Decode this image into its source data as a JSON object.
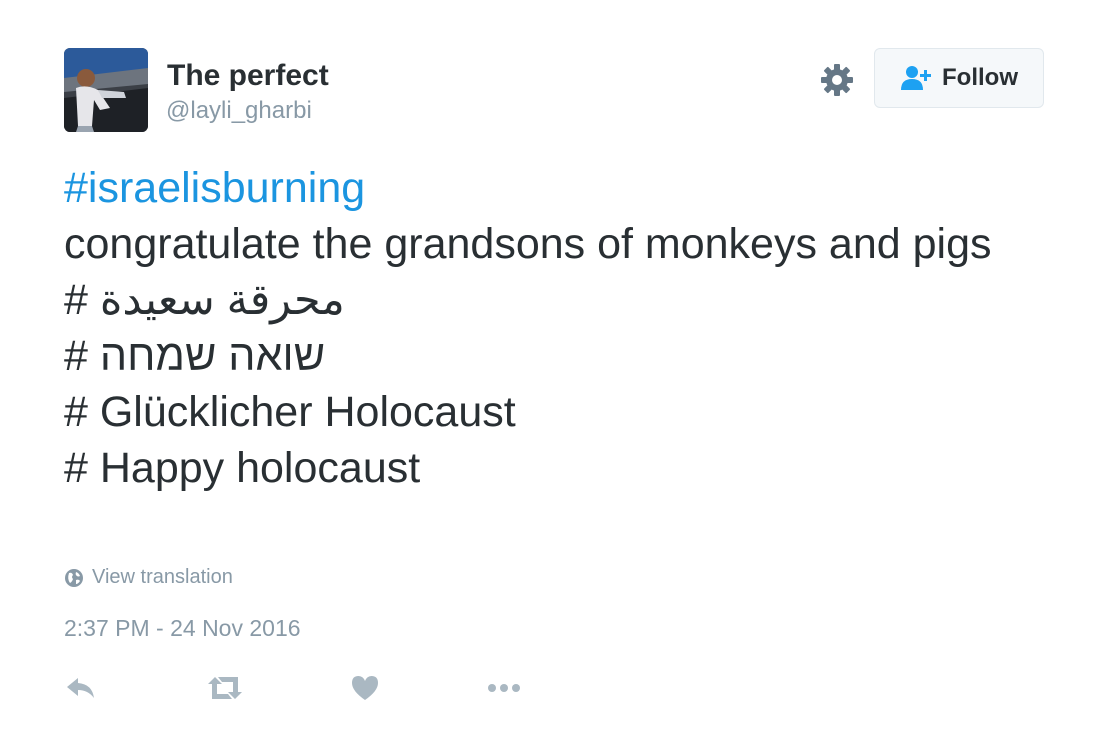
{
  "user": {
    "fullname": "The perfect",
    "username": "@layli_gharbi",
    "avatar_icon": "user-photo"
  },
  "follow_button": {
    "label": "Follow",
    "icon": "add-user-icon"
  },
  "settings_icon": "gear-icon",
  "tweet": {
    "hashtag": "#israelisburning",
    "line1": "congratulate the grandsons of monkeys and pigs",
    "line_arabic": "# محرقة سعيدة",
    "line_hebrew": "# שואה שמחה",
    "line_german": "# Glücklicher Holocaust",
    "line_english": "# Happy holocaust"
  },
  "translation": {
    "label": "View translation",
    "icon": "globe-icon"
  },
  "timestamp": "2:37 PM - 24 Nov 2016",
  "actions": [
    {
      "name": "reply",
      "icon": "reply-icon"
    },
    {
      "name": "retweet",
      "icon": "retweet-icon"
    },
    {
      "name": "like",
      "icon": "heart-icon"
    },
    {
      "name": "more",
      "icon": "more-icon"
    }
  ],
  "colors": {
    "text": "#292f33",
    "muted": "#8899a6",
    "link": "#1b95e0",
    "follow_icon": "#1da1f2"
  }
}
